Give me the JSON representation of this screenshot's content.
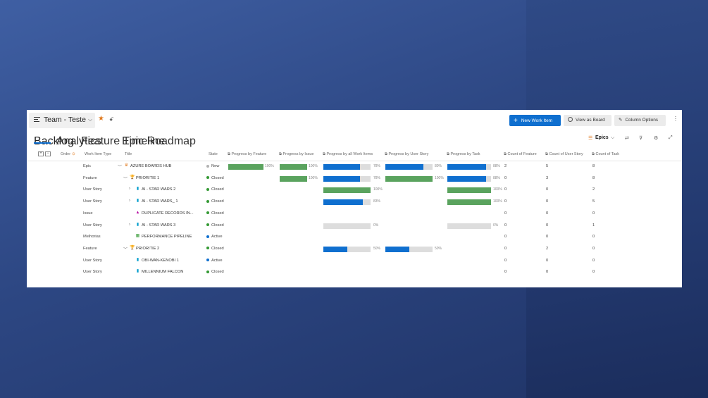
{
  "header": {
    "team_name": "Team - Teste",
    "chevron": "⌵",
    "star": "★",
    "people": "ꗃ",
    "new_work_item": "New Work Item",
    "view_as_board": "View as Board",
    "column_options": "Column Options",
    "more": "⋮"
  },
  "tabs": [
    "Backlog",
    "Analytics",
    "Feature Timeline",
    "Epic Roadmap"
  ],
  "toolbar": {
    "epics": "Epics",
    "epics_chevron": "⌵",
    "sort": "⇄",
    "filter": "⊽",
    "settings": "⚙",
    "expand": "⤢"
  },
  "columns": {
    "expand_plus": "+",
    "collapse_minus": "−",
    "order": "Order",
    "work_item_type": "Work Item Type",
    "title": "Title",
    "state": "State",
    "prog_feature": "Progress by Feature",
    "prog_issue": "Progress by Issue",
    "prog_all": "Progress by all Work Items",
    "prog_story": "Progress by User Story",
    "prog_task": "Progress by Task",
    "count_feature": "Count of Feature",
    "count_story": "Count of User Story",
    "count_task": "Count of Task"
  },
  "colors": {
    "primary": "#0f6fcf",
    "green": "#5aa35e",
    "blue": "#0f6fcf",
    "gray": "#dddddd",
    "new_state": "#b2b2b2",
    "closed_state": "#339933",
    "active_state": "#0f6fcf"
  },
  "rows": [
    {
      "type": "Epic",
      "title": "AZURE BOARDS HUB",
      "icon": "crown-icon",
      "caret": "﹀",
      "state": "New",
      "pf": {
        "v": 1.0,
        "t": "100%",
        "c": "green"
      },
      "pi": {
        "v": 1.0,
        "t": "100%",
        "c": "green"
      },
      "pa": {
        "v": 0.78,
        "t": "78%",
        "c": "blue"
      },
      "ps": {
        "v": 0.8,
        "t": "80%",
        "c": "blue"
      },
      "pt": {
        "v": 0.88,
        "t": "88%",
        "c": "blue"
      },
      "cf": "2",
      "cs": "5",
      "ct": "8"
    },
    {
      "type": "Feature",
      "title": "PRIORITIE 1",
      "icon": "trophy-icon",
      "caret": "﹀",
      "state": "Closed",
      "pf": null,
      "pi": {
        "v": 1.0,
        "t": "100%",
        "c": "green"
      },
      "pa": {
        "v": 0.78,
        "t": "78%",
        "c": "blue"
      },
      "ps": {
        "v": 1.0,
        "t": "100%",
        "c": "green"
      },
      "pt": {
        "v": 0.88,
        "t": "88%",
        "c": "blue"
      },
      "cf": "0",
      "cs": "3",
      "ct": "8"
    },
    {
      "type": "User Story",
      "title": "AI - STAR WARS 2",
      "icon": "book-icon",
      "caret": "›",
      "state": "Closed",
      "pf": null,
      "pi": null,
      "pa": {
        "v": 1.0,
        "t": "100%",
        "c": "green"
      },
      "ps": null,
      "pt": {
        "v": 1.0,
        "t": "100%",
        "c": "green"
      },
      "cf": "0",
      "cs": "0",
      "ct": "2"
    },
    {
      "type": "User Story",
      "title": "AI - STAR WARS_ 1",
      "icon": "book-icon",
      "caret": "›",
      "state": "Closed",
      "pf": null,
      "pi": null,
      "pa": {
        "v": 0.83,
        "t": "83%",
        "c": "blue"
      },
      "ps": null,
      "pt": {
        "v": 1.0,
        "t": "100%",
        "c": "green"
      },
      "cf": "0",
      "cs": "0",
      "ct": "5"
    },
    {
      "type": "Issue",
      "title": "DUPLICATE RECORDS IN...",
      "icon": "flask-icon",
      "caret": "",
      "state": "Closed",
      "pf": null,
      "pi": null,
      "pa": null,
      "ps": null,
      "pt": null,
      "cf": "0",
      "cs": "0",
      "ct": "0"
    },
    {
      "type": "User Story",
      "title": "AI - STAR WARS 3",
      "icon": "book-icon",
      "caret": "›",
      "state": "Closed",
      "pf": null,
      "pi": null,
      "pa": {
        "v": 0.0,
        "t": "0%",
        "c": "gray"
      },
      "ps": null,
      "pt": {
        "v": 0.0,
        "t": "0%",
        "c": "gray"
      },
      "cf": "0",
      "cs": "0",
      "ct": "1"
    },
    {
      "type": "Melhorias",
      "title": "PERFORMANCE PIPELINE",
      "icon": "board-icon",
      "caret": "",
      "state": "Active",
      "pf": null,
      "pi": null,
      "pa": null,
      "ps": null,
      "pt": null,
      "cf": "0",
      "cs": "0",
      "ct": "0"
    },
    {
      "type": "Feature",
      "title": "PRIORITIE 2",
      "icon": "trophy-icon",
      "caret": "﹀",
      "state": "Closed",
      "pf": null,
      "pi": null,
      "pa": {
        "v": 0.5,
        "t": "50%",
        "c": "blue"
      },
      "ps": {
        "v": 0.5,
        "t": "50%",
        "c": "blue"
      },
      "pt": null,
      "cf": "0",
      "cs": "2",
      "ct": "0"
    },
    {
      "type": "User Story",
      "title": "OBI-WAN-KENOBI 1",
      "icon": "book-icon",
      "caret": "",
      "state": "Active",
      "pf": null,
      "pi": null,
      "pa": null,
      "ps": null,
      "pt": null,
      "cf": "0",
      "cs": "0",
      "ct": "0"
    },
    {
      "type": "User Story",
      "title": "MILLENNIUM FALCON",
      "icon": "book-icon",
      "caret": "",
      "state": "Closed",
      "pf": null,
      "pi": null,
      "pa": null,
      "ps": null,
      "pt": null,
      "cf": "0",
      "cs": "0",
      "ct": "0"
    }
  ]
}
